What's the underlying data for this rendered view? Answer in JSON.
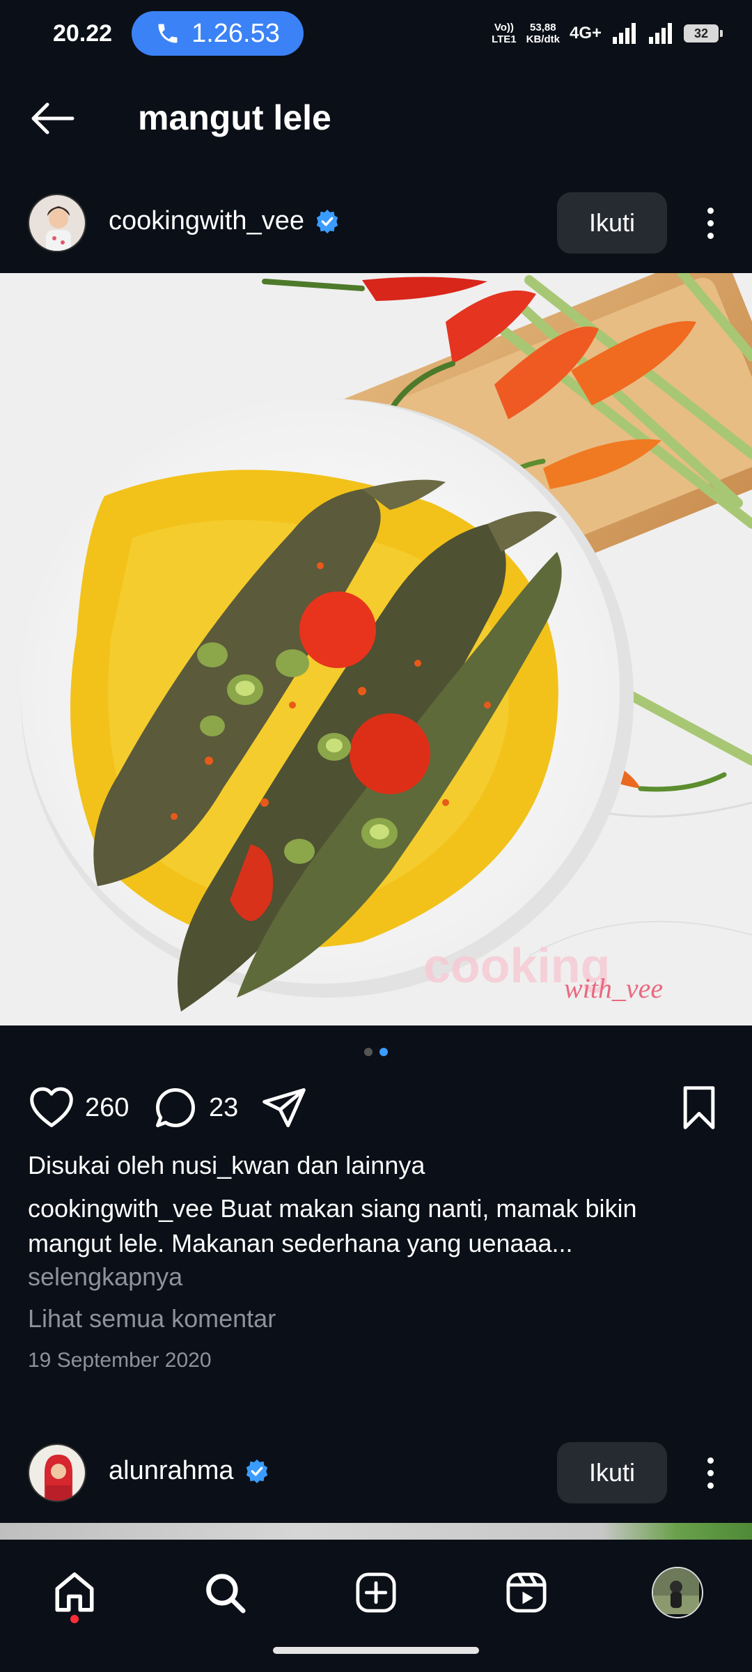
{
  "status_bar": {
    "time": "20.22",
    "call_timer": "1.26.53",
    "volte_line1": "Vo))",
    "volte_line2": "LTE1",
    "speed_value": "53,88",
    "speed_unit": "KB/dtk",
    "network": "4G+",
    "battery": "32"
  },
  "header": {
    "title": "mangut lele",
    "back_icon": "arrow-left-icon"
  },
  "post": {
    "username": "cookingwith_vee",
    "verified": true,
    "follow_label": "Ikuti",
    "watermark_main": "cooking",
    "watermark_sub": "with_vee",
    "carousel": {
      "count": 2,
      "active": 2
    },
    "likes_count": "260",
    "comments_count": "23",
    "liked_by": "Disukai oleh nusi_kwan dan lainnya",
    "caption_user": "cookingwith_vee",
    "caption_text": "Buat makan siang nanti, mamak bikin mangut lele. Makanan sederhana yang uenaaa...",
    "more_label": "selengkapnya",
    "view_comments": "Lihat semua komentar",
    "date": "19 September 2020"
  },
  "next_post": {
    "username": "alunrahma",
    "verified": true,
    "follow_label": "Ikuti"
  },
  "bottom_nav": {
    "items": [
      "home-icon",
      "search-icon",
      "create-icon",
      "reels-icon",
      "profile-avatar"
    ],
    "active": "home-icon"
  },
  "colors": {
    "background": "#0b0f17",
    "accent": "#3b9cff",
    "call_pill": "#3b82f6",
    "muted_text": "#8e939b",
    "button_bg": "#262a31"
  }
}
